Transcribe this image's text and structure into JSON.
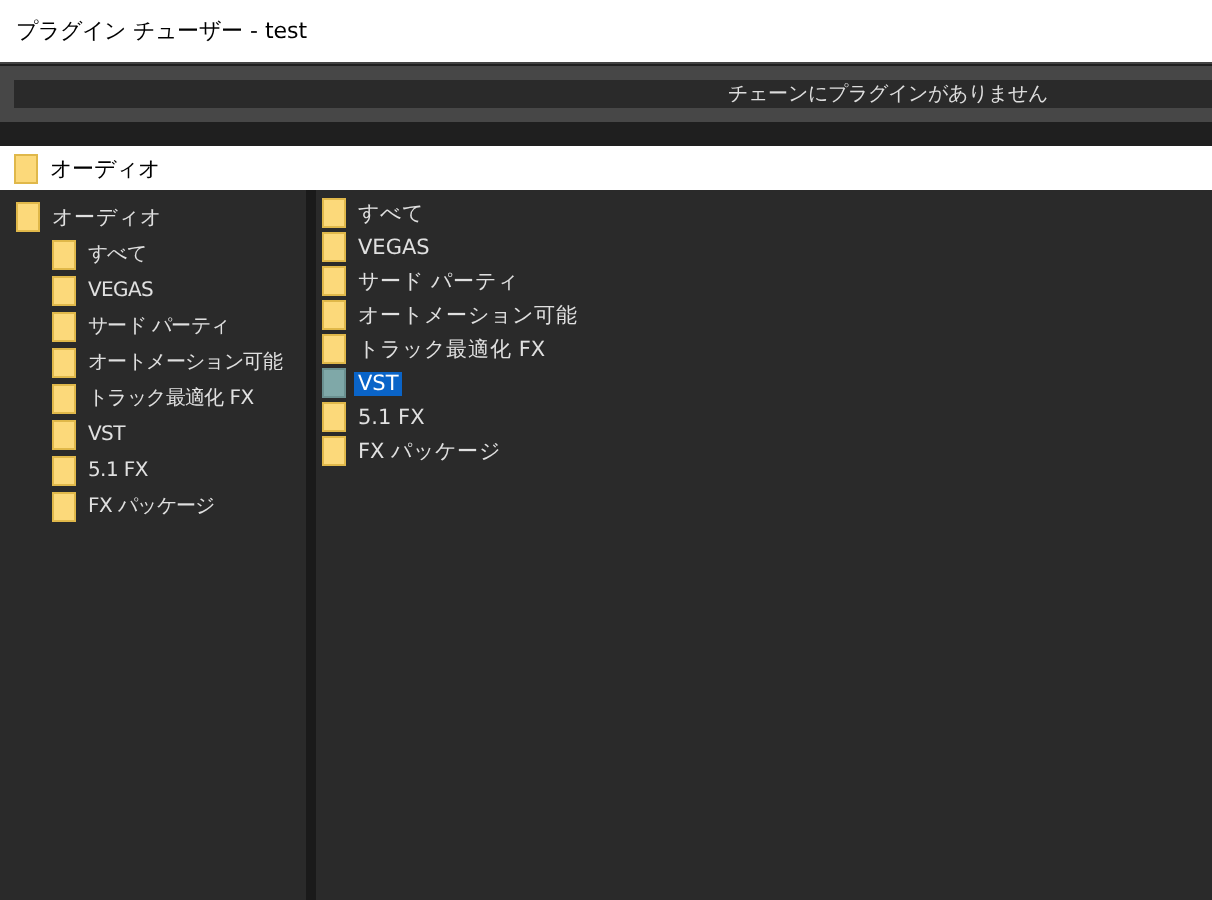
{
  "window": {
    "title": "プラグイン チューザー - test"
  },
  "chain": {
    "text": "チェーンにプラグインがありません"
  },
  "path_field": {
    "value": "オーディオ"
  },
  "tree": [
    {
      "label": "オーディオ",
      "children": [
        {
          "label": "すべて"
        },
        {
          "label": "VEGAS"
        },
        {
          "label": "サード パーティ"
        },
        {
          "label": "オートメーション可能"
        },
        {
          "label": "トラック最適化 FX"
        },
        {
          "label": "VST"
        },
        {
          "label": "5.1 FX"
        },
        {
          "label": "FX パッケージ"
        }
      ]
    }
  ],
  "list": [
    {
      "label": "すべて",
      "selected": false
    },
    {
      "label": "VEGAS",
      "selected": false
    },
    {
      "label": "サード パーティ",
      "selected": false
    },
    {
      "label": "オートメーション可能",
      "selected": false
    },
    {
      "label": "トラック最適化 FX",
      "selected": false
    },
    {
      "label": "VST",
      "selected": true
    },
    {
      "label": "5.1 FX",
      "selected": false
    },
    {
      "label": "FX パッケージ",
      "selected": false
    }
  ]
}
